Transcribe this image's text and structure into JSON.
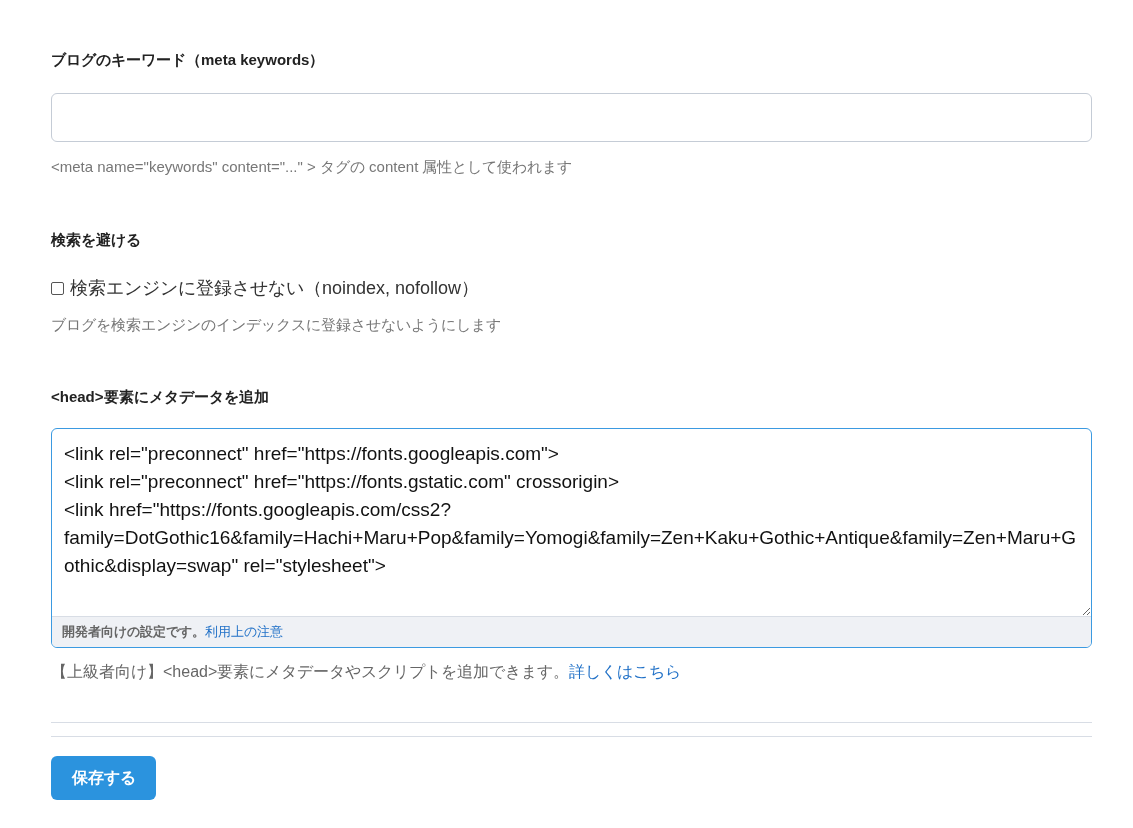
{
  "keywords": {
    "label": "ブログのキーワード（meta keywords）",
    "hint": "<meta name=\"keywords\" content=\"...\" > タグの content 属性として使われます"
  },
  "noindex": {
    "label": "検索を避ける",
    "checkbox_label": "検索エンジンに登録させない（noindex, nofollow）",
    "checked": false,
    "hint": "ブログを検索エンジンのインデックスに登録させないようにします"
  },
  "head_meta": {
    "label": "<head>要素にメタデータを追加",
    "value": "<link rel=\"preconnect\" href=\"https://fonts.googleapis.com\">\n<link rel=\"preconnect\" href=\"https://fonts.gstatic.com\" crossorigin>\n<link href=\"https://fonts.googleapis.com/css2?family=DotGothic16&family=Hachi+Maru+Pop&family=Yomogi&family=Zen+Kaku+Gothic+Antique&family=Zen+Maru+Gothic&display=swap\" rel=\"stylesheet\">",
    "footer_note": "開発者向けの設定です。",
    "footer_link": "利用上の注意",
    "hint": "【上級者向け】<head>要素にメタデータやスクリプトを追加できます。",
    "hint_link": "詳しくはこちら"
  },
  "save_button": "保存する"
}
